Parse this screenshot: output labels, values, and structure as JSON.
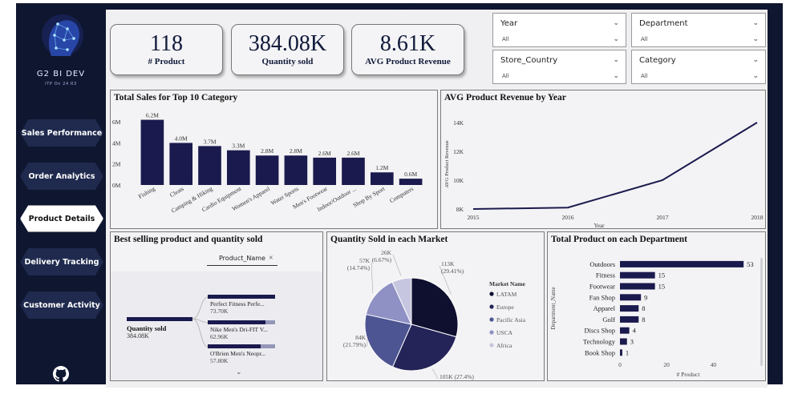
{
  "brand": {
    "title": "G2 BI DEV",
    "subtitle": "ITP On 24 R3"
  },
  "nav": [
    {
      "label": "Sales Performance",
      "active": false
    },
    {
      "label": "Order Analytics",
      "active": false
    },
    {
      "label": "Product Details",
      "active": true
    },
    {
      "label": "Delivery Tracking",
      "active": false
    },
    {
      "label": "Customer Activity",
      "active": false
    }
  ],
  "kpis": [
    {
      "value": "118",
      "label": "# Product"
    },
    {
      "value": "384.08K",
      "label": "Quantity sold"
    },
    {
      "value": "8.61K",
      "label": "AVG Product Revenue"
    }
  ],
  "slicers": [
    {
      "title": "Year",
      "value": "All"
    },
    {
      "title": "Department",
      "value": "All"
    },
    {
      "title": "Store_Country",
      "value": "All"
    },
    {
      "title": "Category",
      "value": "All"
    }
  ],
  "panels": {
    "top10": "Total Sales for Top 10 Category",
    "avg_rev": "AVG Product Revenue by Year",
    "best": "Best selling product and quantity sold",
    "market": "Quantity Sold in each Market",
    "dept": "Total Product on each Department"
  },
  "decomp": {
    "field_chip": "Product_Name",
    "root_label": "Quantity sold",
    "root_value": "384.08K",
    "items": [
      {
        "label": "Perfect Fitness Perfe...",
        "value": "73.70K",
        "share": 1.0
      },
      {
        "label": "Nike Men's Dri-FIT V...",
        "value": "62.96K",
        "share": 0.854
      },
      {
        "label": "O'Brien Men's Neopr...",
        "value": "57.80K",
        "share": 0.784
      }
    ]
  },
  "chart_data": [
    {
      "type": "bar",
      "categories": [
        "Fishing",
        "Cleats",
        "Camping & Hiking",
        "Cardio Equipment",
        "Women's Apparel",
        "Water Sports",
        "Men's Footwear",
        "Indoor/Outdoor ...",
        "Shop By Sport",
        "Computers"
      ],
      "values": [
        6.2,
        4.0,
        3.7,
        3.3,
        2.8,
        2.8,
        2.6,
        2.6,
        1.2,
        0.6
      ],
      "data_labels": [
        "6.2M",
        "4.0M",
        "3.7M",
        "3.3M",
        "2.8M",
        "2.8M",
        "2.6M",
        "2.6M",
        "1.2M",
        "0.6M"
      ],
      "y_ticks": [
        "0M",
        "2M",
        "4M",
        "6M"
      ],
      "ylim": [
        0,
        6.7
      ],
      "color": "#1b1a4e"
    },
    {
      "type": "line",
      "x": [
        2015,
        2016,
        2017,
        2018
      ],
      "y": [
        8.0,
        8.1,
        10.0,
        14.0
      ],
      "x_ticks": [
        "2015",
        "2016",
        "2017",
        "2018"
      ],
      "y_ticks": [
        "8K",
        "10K",
        "12K",
        "14K"
      ],
      "ylim": [
        8,
        14
      ],
      "xlabel": "Year",
      "ylabel": "AVG Product Revenue",
      "color": "#1b1a4e"
    },
    {
      "type": "pie",
      "legend_title": "Market Name",
      "slices": [
        {
          "name": "LATAM",
          "value": 113,
          "label": "113K",
          "pct": "(29.41%)",
          "color": "#0f1030"
        },
        {
          "name": "Europe",
          "value": 105,
          "label": "105K",
          "pct": "(27.4%)",
          "color": "#242458"
        },
        {
          "name": "Pacific Asia",
          "value": 84,
          "label": "84K",
          "pct": "(21.79%)",
          "color": "#4d5592"
        },
        {
          "name": "USCA",
          "value": 57,
          "label": "57K",
          "pct": "(14.74%)",
          "color": "#8f91c4"
        },
        {
          "name": "Africa",
          "value": 26,
          "label": "26K",
          "pct": "(6.67%)",
          "color": "#c6c6e0"
        }
      ]
    },
    {
      "type": "bar",
      "orientation": "horizontal",
      "categories": [
        "Outdoors",
        "Fitness",
        "Footwear",
        "Fan Shop",
        "Apparel",
        "Golf",
        "Discs Shop",
        "Technology",
        "Book Shop"
      ],
      "values": [
        53,
        15,
        15,
        9,
        8,
        8,
        4,
        3,
        1
      ],
      "x_ticks": [
        "0",
        "20",
        "40"
      ],
      "xlim": [
        0,
        55
      ],
      "xlabel": "# Product",
      "ylabel": "Department_Name",
      "color": "#1b1a4e"
    }
  ]
}
